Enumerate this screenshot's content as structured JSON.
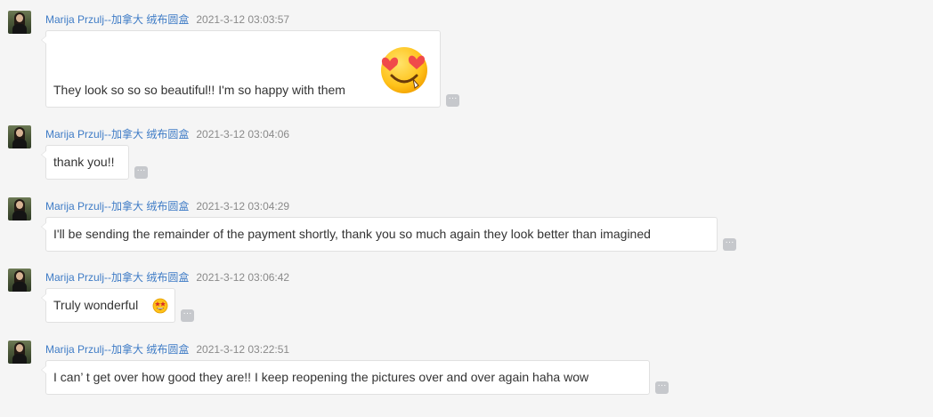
{
  "messages": [
    {
      "sender": "Marija Przulj--加拿大 绒布圆盒",
      "time": "2021-3-12 03:03:57",
      "text": "They look so so so beautiful!! I'm so happy with them",
      "emoji": "heart-eyes-emoji"
    },
    {
      "sender": "Marija Przulj--加拿大 绒布圆盒",
      "time": "2021-3-12 03:04:06",
      "text": "thank you!!"
    },
    {
      "sender": "Marija Przulj--加拿大 绒布圆盒",
      "time": "2021-3-12 03:04:29",
      "text": "I'll be sending the remainder of the payment shortly, thank you so much again they look better than imagined"
    },
    {
      "sender": "Marija Przulj--加拿大 绒布圆盒",
      "time": "2021-3-12 03:06:42",
      "text": "Truly wonderful",
      "emoji": "star-struck-emoji"
    },
    {
      "sender": "Marija Przulj--加拿大 绒布圆盒",
      "time": "2021-3-12 03:22:51",
      "text": "I can’ t get over how good they are!! I keep reopening the pictures over and over again haha wow"
    }
  ],
  "more_label": "···"
}
